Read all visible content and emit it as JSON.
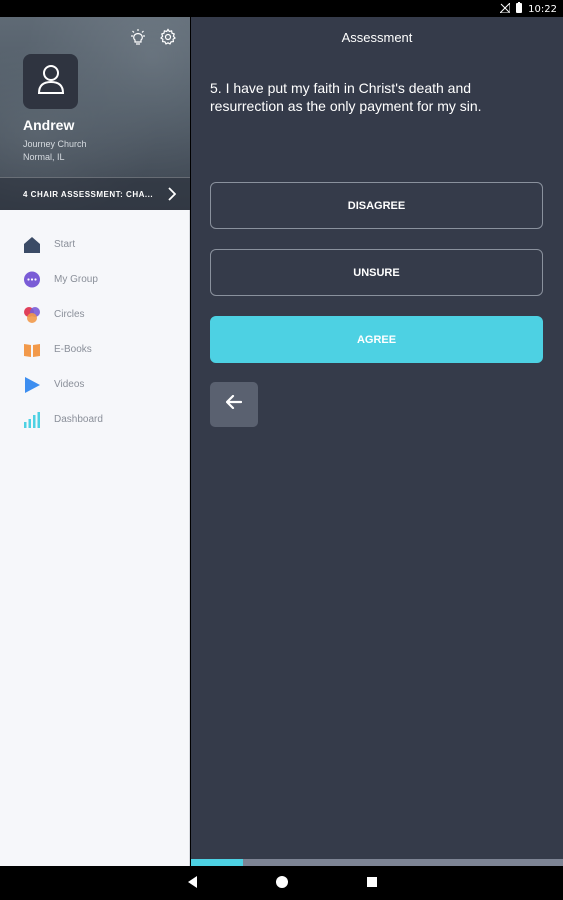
{
  "status_bar": {
    "time": "10:22",
    "icons": [
      "signal-off-icon",
      "battery-icon"
    ]
  },
  "sidebar": {
    "profile": {
      "name": "Andrew",
      "church": "Journey Church",
      "location": "Normal, IL",
      "icons": [
        "lightbulb-icon",
        "gear-icon",
        "user-avatar-icon"
      ]
    },
    "assessment_banner": "4 CHAIR ASSESSMENT: CHA...",
    "items": [
      {
        "label": "Start",
        "icon": "house-icon",
        "color": "#3b4b66"
      },
      {
        "label": "My Group",
        "icon": "chat-bubble-icon",
        "color": "#7a5cd6"
      },
      {
        "label": "Circles",
        "icon": "circles-icon",
        "color": "#e0405a"
      },
      {
        "label": "E-Books",
        "icon": "book-icon",
        "color": "#f2994a"
      },
      {
        "label": "Videos",
        "icon": "play-icon",
        "color": "#3d8ef0"
      },
      {
        "label": "Dashboard",
        "icon": "bar-chart-icon",
        "color": "#4dd1e3"
      }
    ]
  },
  "main": {
    "title": "Assessment",
    "question": "5. I have put my faith in Christ's death and resurrection as the only payment for my sin.",
    "answers": {
      "disagree": "DISAGREE",
      "unsure": "UNSURE",
      "agree": "AGREE"
    },
    "progress_fraction": 0.14
  },
  "colors": {
    "accent": "#4dd1e3",
    "panel_bg": "#353b4a",
    "sidebar_bg": "#f6f7fa"
  }
}
